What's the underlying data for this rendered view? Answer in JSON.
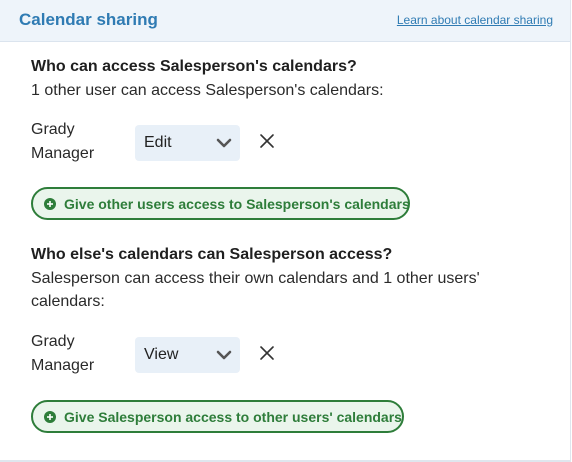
{
  "header": {
    "title": "Calendar sharing",
    "learn_link": "Learn about calendar sharing"
  },
  "section_access": {
    "heading": "Who can access Salesperson's calendars?",
    "description": "1 other user can access Salesperson's calendars:",
    "users": [
      {
        "name": "Grady Manager",
        "permission": "Edit"
      }
    ],
    "add_button": "Give other users access to Salesperson's calendars"
  },
  "section_others": {
    "heading": "Who else's calendars can Salesperson access?",
    "description": "Salesperson can access their own calendars and 1 other users' calendars:",
    "users": [
      {
        "name": "Grady Manager",
        "permission": "View"
      }
    ],
    "add_button": "Give Salesperson access to other users' calendars"
  },
  "colors": {
    "title_blue": "#2f7bb3",
    "header_bg": "#eef4fa",
    "select_bg": "#e8f0f8",
    "button_green": "#2e7d3a",
    "button_bg": "#eaf5ec"
  },
  "icons": {
    "dropdown": "chevron-down-icon",
    "remove": "close-icon",
    "add": "plus-circle-icon"
  }
}
